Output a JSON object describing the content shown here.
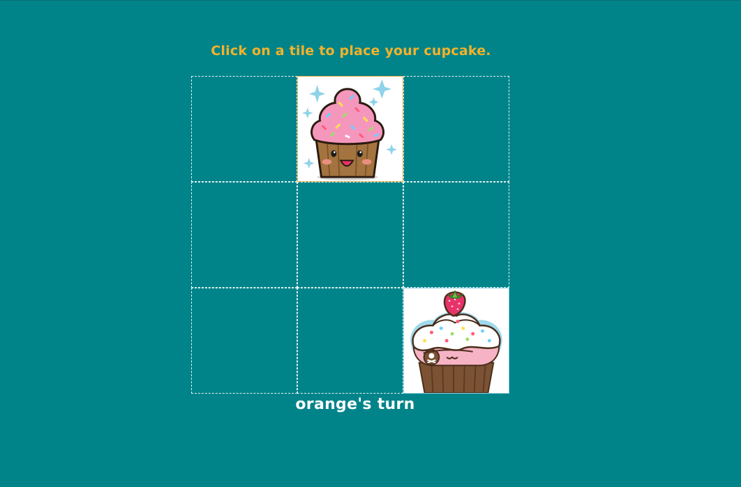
{
  "instructions": "Click on a tile to place your cupcake.",
  "turn_status": "orange's turn",
  "colors": {
    "background": "#008489",
    "instruction_text": "#f4b22a",
    "status_text": "#ffffff"
  },
  "board": {
    "tiles": [
      {
        "position": 1,
        "piece": "empty"
      },
      {
        "position": 2,
        "piece": "orange-cupcake"
      },
      {
        "position": 3,
        "piece": "empty"
      },
      {
        "position": 4,
        "piece": "empty"
      },
      {
        "position": 5,
        "piece": "empty"
      },
      {
        "position": 6,
        "piece": "empty"
      },
      {
        "position": 7,
        "piece": "empty"
      },
      {
        "position": 8,
        "piece": "empty"
      },
      {
        "position": 9,
        "piece": "pink-cupcake"
      }
    ]
  }
}
